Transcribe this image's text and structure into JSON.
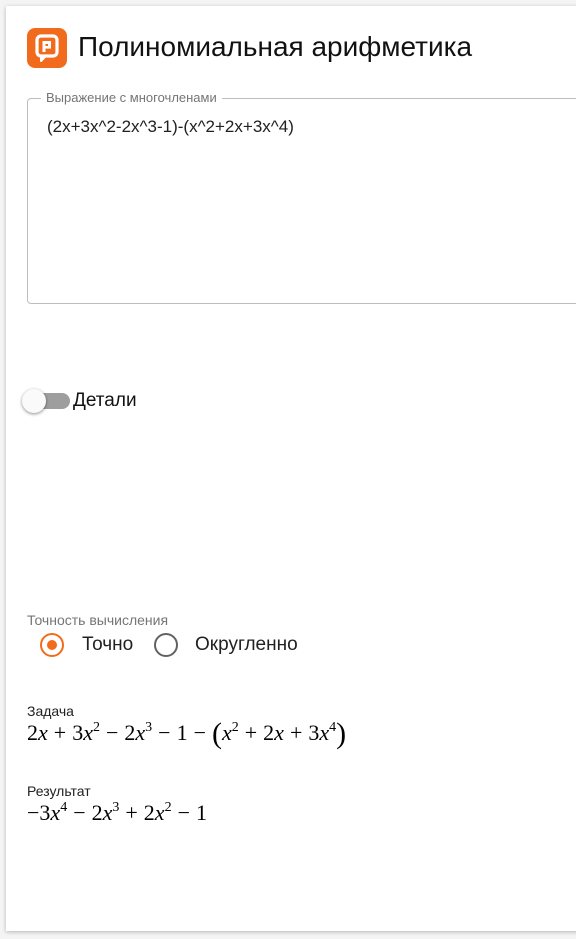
{
  "app": {
    "title": "Полиномиальная арифметика",
    "accent_color": "#f26b1d",
    "logo_icon": "p-badge-icon"
  },
  "expression_field": {
    "legend": "Выражение с многочленами",
    "value": "(2x+3x^2-2x^3-1)-(x^2+2x+3x^4)"
  },
  "details_toggle": {
    "label": "Детали",
    "checked": false
  },
  "precision": {
    "label": "Точность вычисления",
    "options": [
      {
        "label": "Точно",
        "selected": true
      },
      {
        "label": "Округленно",
        "selected": false
      }
    ]
  },
  "task": {
    "label": "Задача",
    "formula": "2x + 3x^2 - 2x^3 - 1 - (x^2 + 2x + 3x^4)"
  },
  "result": {
    "label": "Результат",
    "formula": "-3x^4 - 2x^3 + 2x^2 - 1"
  }
}
